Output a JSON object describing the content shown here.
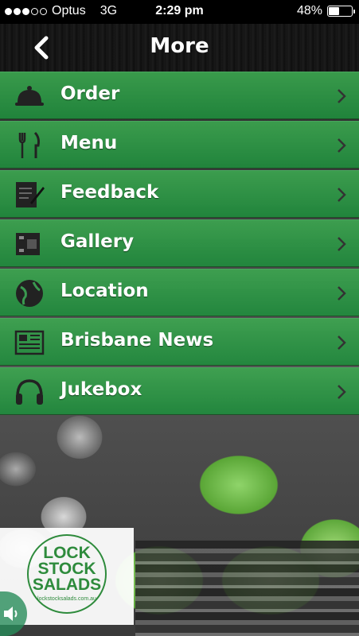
{
  "status_bar": {
    "carrier": "Optus",
    "network": "3G",
    "time": "2:29 pm",
    "battery_percent": "48%",
    "battery_level": 0.48,
    "signal_bars": 3,
    "signal_total": 5
  },
  "nav": {
    "title": "More",
    "back_icon": "chevron-left-icon"
  },
  "menu": {
    "items": [
      {
        "label": "Order",
        "icon": "cloche-icon"
      },
      {
        "label": "Menu",
        "icon": "fork-knife-icon"
      },
      {
        "label": "Feedback",
        "icon": "document-pen-icon"
      },
      {
        "label": "Gallery",
        "icon": "film-strip-icon"
      },
      {
        "label": "Location",
        "icon": "globe-icon"
      },
      {
        "label": "Brisbane News",
        "icon": "newspaper-icon"
      },
      {
        "label": "Jukebox",
        "icon": "headphones-icon"
      }
    ]
  },
  "logo": {
    "line1": "LOCK",
    "line2": "STOCK",
    "line3": "SALADS",
    "url": "lockstocksalads.com.au"
  },
  "sound": {
    "icon": "speaker-icon"
  },
  "colors": {
    "menu_green": "#2ea048",
    "brand_green": "#2e8b3c"
  }
}
